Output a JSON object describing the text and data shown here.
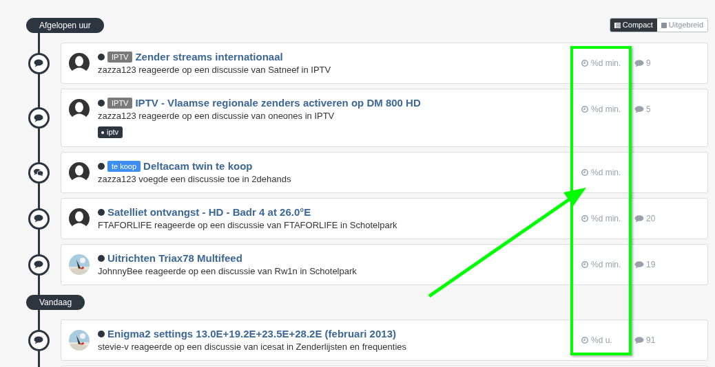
{
  "view_toggle": [
    {
      "label": "Compact",
      "selected": true
    },
    {
      "label": "Uitgebreid",
      "selected": false
    }
  ],
  "sections": [
    {
      "label": "Afgelopen uur",
      "items": [
        {
          "kind": "activity",
          "node": {
            "kind": "comment"
          },
          "avatar": {
            "kind": "default"
          },
          "prefix": {
            "text": "IPTV",
            "color": "#7a7a7a"
          },
          "title": "Zender streams internationaal",
          "subtitle": "zazza123 reageerde op een discussie van Satneef in IPTV",
          "time": "%d min.",
          "count": "9"
        },
        {
          "kind": "activity",
          "node": {
            "kind": "comment"
          },
          "avatar": {
            "kind": "default"
          },
          "prefix": {
            "text": "IPTV",
            "color": "#7a7a7a"
          },
          "title": "IPTV - Vlaamse regionale zenders activeren op DM 800 HD",
          "subtitle": "zazza123 reageerde op een discussie van oneones in IPTV",
          "tags": [
            "iptv"
          ],
          "time": "%d min.",
          "count": "5"
        },
        {
          "kind": "activity",
          "node": {
            "kind": "comments"
          },
          "avatar": {
            "kind": "default"
          },
          "prefix": {
            "text": "te koop",
            "color": "#3d8ef0"
          },
          "title": "Deltacam twin te koop",
          "subtitle": "zazza123 voegde een discussie toe in 2dehands",
          "time": "%d min."
        },
        {
          "kind": "activity",
          "node": {
            "kind": "comment"
          },
          "avatar": {
            "kind": "default"
          },
          "title": "Satelliet ontvangst - HD - Badr 4 at 26.0°E",
          "subtitle": "FTAFORLIFE reageerde op een discussie van FTAFORLIFE in Schotelpark",
          "time": "%d min.",
          "count": "20"
        },
        {
          "kind": "activity",
          "node": {
            "kind": "comment"
          },
          "title": "Uitrichten Triax78 Multifeed",
          "subtitle": "JohnnyBee reageerde op een discussie van Rw1n in Schotelpark",
          "time": "%d min.",
          "count": "19"
        }
      ]
    },
    {
      "label": "Vandaag",
      "items": [
        {
          "kind": "activity",
          "node": {
            "kind": "comment"
          },
          "title": "Enigma2 settings 13.0E+19.2E+23.5E+28.2E (februari 2013)",
          "subtitle": "stevie-v reageerde op een discussie van icesat in Zenderlijsten en frequenties",
          "time": "%d u.",
          "count": "91"
        },
        {
          "kind": "cut-off"
        }
      ]
    }
  ]
}
